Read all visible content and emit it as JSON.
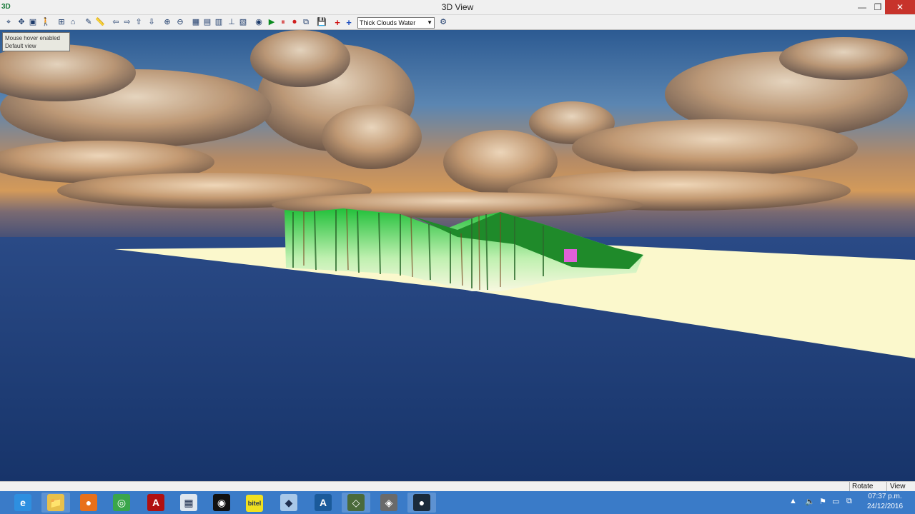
{
  "window": {
    "title": "3D View",
    "app_icon": "3D",
    "minimize": "—",
    "maximize": "❐",
    "close": "✕"
  },
  "toolbar": {
    "buttons": [
      {
        "name": "select-tool-icon",
        "glyph": "⌖"
      },
      {
        "name": "pan-tool-icon",
        "glyph": "✥"
      },
      {
        "name": "frame-icon",
        "glyph": "▣"
      },
      {
        "name": "walk-icon",
        "glyph": "🚶"
      },
      {
        "name": "grid-icon",
        "glyph": "⊞"
      },
      {
        "name": "home-icon",
        "glyph": "⌂"
      },
      {
        "name": "draw-icon",
        "glyph": "✎"
      },
      {
        "name": "ruler-icon",
        "glyph": "📏"
      },
      {
        "name": "arrow-left-icon",
        "glyph": "⇦"
      },
      {
        "name": "arrow-right-icon",
        "glyph": "⇨"
      },
      {
        "name": "arrow-up-icon",
        "glyph": "⇧"
      },
      {
        "name": "arrow-down-icon",
        "glyph": "⇩"
      },
      {
        "name": "zoom-in-icon",
        "glyph": "⊕"
      },
      {
        "name": "zoom-out-icon",
        "glyph": "⊖"
      },
      {
        "name": "view-top-icon",
        "glyph": "▦"
      },
      {
        "name": "view-side-icon",
        "glyph": "▤"
      },
      {
        "name": "view-front-icon",
        "glyph": "▥"
      },
      {
        "name": "view-axis-icon",
        "glyph": "⊥"
      },
      {
        "name": "view-persp-icon",
        "glyph": "▧"
      },
      {
        "name": "camera-icon",
        "glyph": "◉"
      },
      {
        "name": "play-icon",
        "glyph": "▶"
      },
      {
        "name": "pause-icon",
        "glyph": "⏸"
      },
      {
        "name": "record-icon",
        "glyph": "⏺"
      },
      {
        "name": "export-icon",
        "glyph": "⧉"
      },
      {
        "name": "save-icon",
        "glyph": "💾"
      },
      {
        "name": "add-red-icon",
        "glyph": "+"
      },
      {
        "name": "add-blue-icon",
        "glyph": "+"
      }
    ],
    "scene_select": "Thick Clouds Water",
    "settings_glyph": "⚙"
  },
  "tooltip": {
    "line1": "Mouse hover enabled",
    "line2": "Default view"
  },
  "status": {
    "mode": "Rotate",
    "view": "View"
  },
  "taskbar": {
    "apps": [
      {
        "name": "ie-icon",
        "glyph": "e",
        "color": "#2e8fe0"
      },
      {
        "name": "file-explorer-icon",
        "glyph": "📁",
        "color": "#e8c04a"
      },
      {
        "name": "firefox-icon",
        "glyph": "●",
        "color": "#e8701a"
      },
      {
        "name": "chrome-icon",
        "glyph": "◎",
        "color": "#3aa64a"
      },
      {
        "name": "acrobat-icon",
        "glyph": "A",
        "color": "#b01010"
      },
      {
        "name": "calculator-icon",
        "glyph": "▦",
        "color": "#dfe6ee"
      },
      {
        "name": "media-icon",
        "glyph": "◉",
        "color": "#111111"
      },
      {
        "name": "bitel-icon",
        "glyph": "bitel",
        "color": "#f0e020"
      },
      {
        "name": "app-cube-icon",
        "glyph": "◆",
        "color": "#a8c8e8"
      },
      {
        "name": "autocad-icon",
        "glyph": "A",
        "color": "#1a5a9a"
      },
      {
        "name": "surveying-icon",
        "glyph": "◇",
        "color": "#4a6a3a"
      },
      {
        "name": "gis-icon",
        "glyph": "◈",
        "color": "#6a6a6a"
      },
      {
        "name": "globe-icon",
        "glyph": "●",
        "color": "#1a2a3a"
      }
    ],
    "clock_time": "07:37 p.m.",
    "clock_date": "24/12/2016"
  },
  "colors": {
    "sea": "#1e3f7a",
    "ground": "#fbf8cc",
    "terrain": "#1faa30",
    "sky_top": "#3a6fa8",
    "horizon": "#c89560"
  }
}
